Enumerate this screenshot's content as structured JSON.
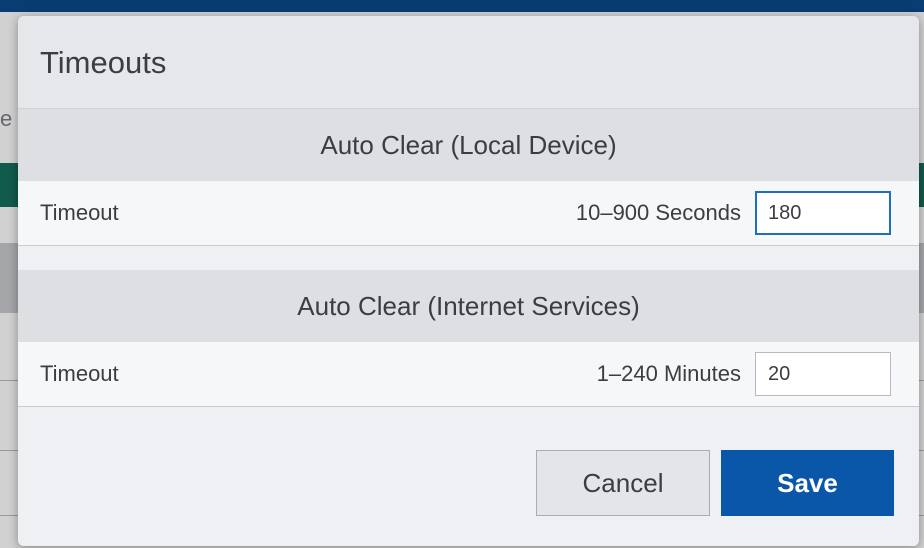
{
  "dialog": {
    "title": "Timeouts",
    "sections": [
      {
        "header": "Auto Clear (Local Device)",
        "rows": [
          {
            "label": "Timeout",
            "range": "10–900 Seconds",
            "value": "180"
          }
        ]
      },
      {
        "header": "Auto Clear (Internet Services)",
        "rows": [
          {
            "label": "Timeout",
            "range": "1–240 Minutes",
            "value": "20"
          }
        ]
      }
    ],
    "buttons": {
      "cancel_label": "Cancel",
      "save_label": "Save"
    }
  },
  "background": {
    "stub_text": "e"
  },
  "colors": {
    "primary": "#0a56a8",
    "focus_border": "#1e6fc4",
    "top_bar": "#0b4a8c",
    "teal_band": "#15705e"
  }
}
